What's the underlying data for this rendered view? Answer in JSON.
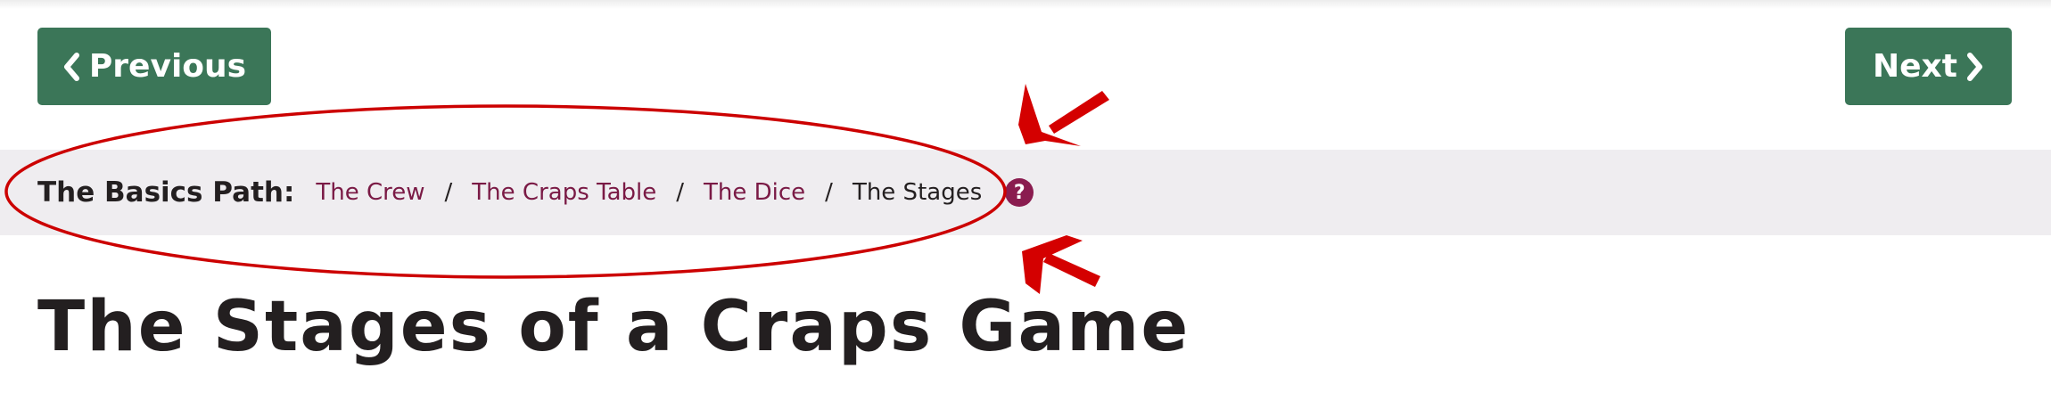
{
  "nav": {
    "previous_label": "Previous",
    "next_label": "Next"
  },
  "breadcrumb": {
    "title": "The Basics Path:",
    "items": [
      {
        "label": "The Crew"
      },
      {
        "label": "The Craps Table"
      },
      {
        "label": "The Dice"
      }
    ],
    "separator": "/",
    "current": "The Stages",
    "help_icon": "question-circle-icon"
  },
  "page": {
    "title": "The Stages of a Craps Game"
  },
  "annotation": {
    "shapes": [
      "ellipse",
      "arrow",
      "arrow"
    ],
    "color": "#cc0000"
  },
  "colors": {
    "button_bg": "#3b7658",
    "link": "#7a1a45",
    "breadcrumb_bg": "#efedf0"
  }
}
